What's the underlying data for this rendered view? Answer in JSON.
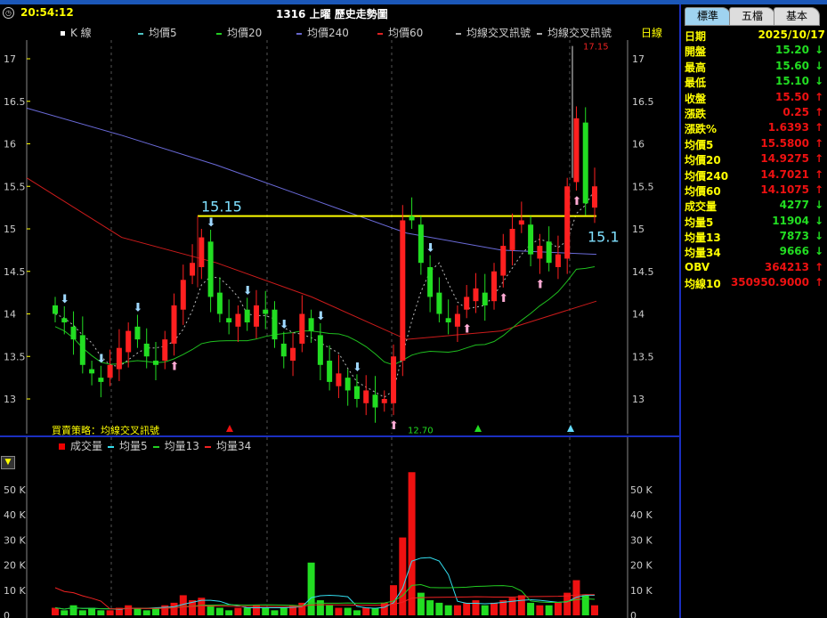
{
  "header": {
    "time": "20:54:12",
    "title": "1316 上曜  歷史走勢圖",
    "period": "日線"
  },
  "legend": [
    {
      "label": "K 線",
      "color": "#ffffff"
    },
    {
      "label": "均價5",
      "color": "#4fc3c3"
    },
    {
      "label": "均價20",
      "color": "#22cc22"
    },
    {
      "label": "均價240",
      "color": "#6666cc"
    },
    {
      "label": "均價60",
      "color": "#dd2222"
    },
    {
      "label": "均線交叉訊號",
      "color": "#aaaaaa"
    },
    {
      "label": "均線交叉訊號",
      "color": "#aaaaaa"
    }
  ],
  "strategy": "買賣策略：均線交叉訊號",
  "volume_legend": [
    {
      "label": "成交量",
      "color": "#ee0000"
    },
    {
      "label": "均量5",
      "color": "#33ddee"
    },
    {
      "label": "均量13",
      "color": "#22cc22"
    },
    {
      "label": "均量34",
      "color": "#ee2222"
    }
  ],
  "tabs": [
    "標準",
    "五檔",
    "基本"
  ],
  "panel": [
    {
      "k": "日期",
      "v": "2025/10/17",
      "c": "#ffff00",
      "a": ""
    },
    {
      "k": "開盤",
      "v": "15.20",
      "c": "#22dd22",
      "a": "↓"
    },
    {
      "k": "最高",
      "v": "15.60",
      "c": "#22dd22",
      "a": "↓"
    },
    {
      "k": "最低",
      "v": "15.10",
      "c": "#22dd22",
      "a": "↓"
    },
    {
      "k": "收盤",
      "v": "15.50",
      "c": "#ee1111",
      "a": "↑"
    },
    {
      "k": "漲跌",
      "v": "0.25",
      "c": "#ee1111",
      "a": "↑"
    },
    {
      "k": "漲跌%",
      "v": "1.6393",
      "c": "#ee1111",
      "a": "↑"
    },
    {
      "k": "均價5",
      "v": "15.5800",
      "c": "#ee1111",
      "a": "↑"
    },
    {
      "k": "均價20",
      "v": "14.9275",
      "c": "#ee1111",
      "a": "↑"
    },
    {
      "k": "均價240",
      "v": "14.7021",
      "c": "#ee1111",
      "a": "↑"
    },
    {
      "k": "均價60",
      "v": "14.1075",
      "c": "#ee1111",
      "a": "↑"
    },
    {
      "k": "成交量",
      "v": "4277",
      "c": "#22dd22",
      "a": "↓"
    },
    {
      "k": "均量5",
      "v": "11904",
      "c": "#22dd22",
      "a": "↓"
    },
    {
      "k": "均量13",
      "v": "7873",
      "c": "#22dd22",
      "a": "↓"
    },
    {
      "k": "均量34",
      "v": "9666",
      "c": "#22dd22",
      "a": "↓"
    },
    {
      "k": "OBV",
      "v": "364213",
      "c": "#ee1111",
      "a": "↑"
    },
    {
      "k": "均線10",
      "v": "350950.9000",
      "c": "#ee1111",
      "a": "↑"
    }
  ],
  "chart_data": {
    "type": "candlestick",
    "price_ticks": [
      "17",
      "16.5",
      "16",
      "15.5",
      "15",
      "14.5",
      "14",
      "13.5",
      "13"
    ],
    "volume_ticks": [
      "50 K",
      "40 K",
      "30 K",
      "20 K",
      "10 K",
      "0"
    ],
    "ylim": [
      12.6,
      17.2
    ],
    "vol_ylim": [
      0,
      58
    ],
    "closes": [
      14.0,
      13.9,
      13.7,
      13.4,
      13.3,
      13.2,
      13.4,
      13.6,
      13.8,
      13.7,
      13.5,
      13.4,
      13.7,
      14.1,
      14.4,
      14.6,
      14.9,
      14.2,
      14.0,
      13.9,
      14.0,
      13.9,
      14.1,
      14.0,
      13.7,
      13.5,
      13.6,
      14.0,
      13.8,
      13.4,
      13.2,
      13.3,
      13.1,
      13.0,
      13.1,
      12.9,
      13.0,
      13.5,
      15.1,
      15.1,
      14.6,
      14.2,
      14.0,
      13.9,
      14.0,
      14.2,
      14.3,
      14.1,
      14.5,
      14.8,
      15.0,
      15.1,
      14.7,
      14.8,
      14.6,
      14.7,
      15.5,
      16.3,
      15.3,
      15.5
    ],
    "volumes_k": [
      3,
      2,
      4,
      2,
      3,
      2,
      2,
      3,
      4,
      3,
      2,
      3,
      4,
      5,
      8,
      6,
      7,
      4,
      3,
      2,
      3,
      3,
      4,
      3,
      2,
      3,
      4,
      5,
      21,
      6,
      4,
      3,
      3,
      2,
      3,
      3,
      5,
      12,
      31,
      57,
      9,
      6,
      5,
      4,
      4,
      5,
      6,
      4,
      5,
      6,
      7,
      8,
      5,
      4,
      4,
      5,
      9,
      14,
      8,
      4
    ],
    "ma240": [
      16.42,
      16.1,
      15.75,
      15.35,
      14.95,
      14.75,
      14.7
    ],
    "ma60": [
      15.6,
      14.9,
      14.6,
      14.2,
      13.7,
      13.8,
      14.15
    ],
    "hline": {
      "value": 15.15,
      "label": "15.15"
    },
    "right_label": "15.1",
    "high_label": "17.15",
    "low_label": "12.70"
  }
}
